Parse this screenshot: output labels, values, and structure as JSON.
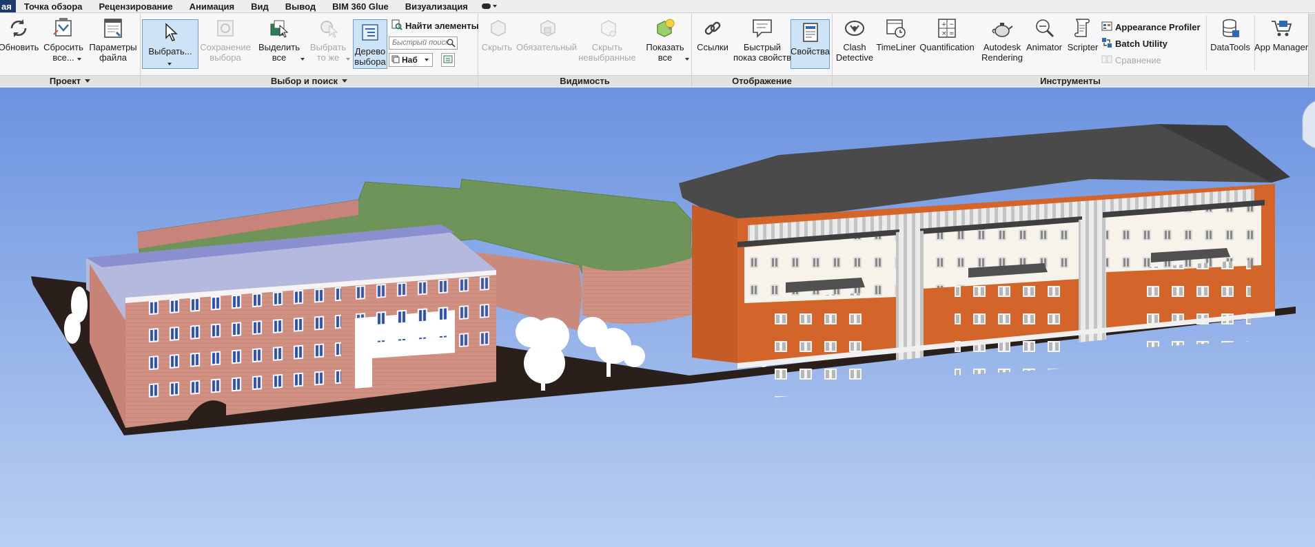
{
  "menu": {
    "tabs": [
      "ая",
      "Точка обзора",
      "Рецензирование",
      "Анимация",
      "Вид",
      "Вывод",
      "BIM 360 Glue",
      "Визуализация"
    ]
  },
  "ribbon": {
    "project": {
      "title": "Проект",
      "refresh": "Обновить",
      "reset_all": "Сбросить\nвсе...",
      "file_options": "Параметры\nфайла"
    },
    "select": {
      "title": "Выбор и поиск",
      "select": "Выбрать...",
      "save_selection": "Сохранение\nвыбора",
      "select_all": "Выделить\nвсе",
      "select_same": "Выбрать\nто же",
      "selection_tree": "Дерево\nвыбора",
      "find_items": "Найти элементы",
      "quick_find_placeholder": "Быстрый поиск",
      "sets_combo": "Наб"
    },
    "visibility": {
      "title": "Видимость",
      "hide": "Скрыть",
      "require": "Обязательный",
      "hide_unselected": "Скрыть\nневыбранные",
      "unhide_all": "Показать\nвсе"
    },
    "display": {
      "title": "Отображение",
      "links": "Ссылки",
      "quick_properties": "Быстрый\nпоказ свойств",
      "properties": "Свойства"
    },
    "tools": {
      "title": "Инструменты",
      "clash_detective": "Clash\nDetective",
      "timeliner": "TimeLiner",
      "quantification": "Quantification",
      "autodesk_rendering": "Autodesk\nRendering",
      "animator": "Animator",
      "scripter": "Scripter",
      "appearance_profiler": "Appearance Profiler",
      "batch_utility": "Batch Utility",
      "compare": "Сравнение",
      "datatools": "DataTools",
      "app_manager": "App Manager"
    }
  },
  "colors": {
    "ribbon_bg": "#f7f7f7",
    "active_tab": "#1a3b6b",
    "selected_button": "#cfe3f6",
    "sky_top": "#6c93e0",
    "sky_bottom": "#b9cff2",
    "brick": "#d09182",
    "orange_facade": "#d4652a",
    "green_roof": "#6f9459",
    "dark_roof": "#4a4a4a"
  },
  "icons": {
    "refresh": "refresh-icon",
    "reset": "reset-icon",
    "options": "file-options-icon",
    "cursor": "select-cursor-icon",
    "tree": "selection-tree-icon",
    "find": "find-items-icon",
    "hide": "hide-icon",
    "unhide": "unhide-all-icon",
    "links": "links-icon",
    "properties": "properties-icon",
    "clash": "clash-detective-icon",
    "timeliner": "timeliner-icon"
  }
}
